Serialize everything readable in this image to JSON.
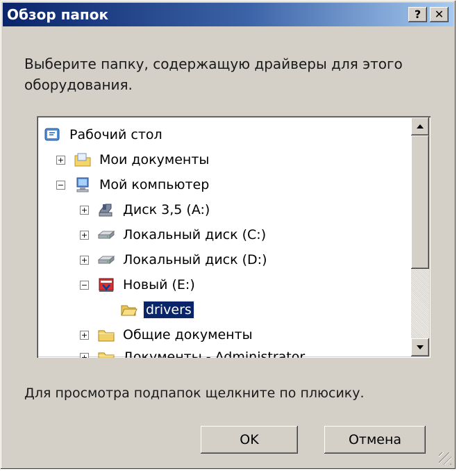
{
  "window": {
    "title": "Обзор папок",
    "help_label": "?",
    "close_label": "✕"
  },
  "prompt": "Выберите папку, содержащую драйверы для этого оборудования.",
  "tree": {
    "items": [
      {
        "label": "Рабочий стол",
        "icon": "desktop-icon",
        "expander": ""
      },
      {
        "label": "Мои документы",
        "icon": "documents-folder-icon",
        "expander": "+"
      },
      {
        "label": "Мой компьютер",
        "icon": "computer-icon",
        "expander": "−"
      },
      {
        "label": "Диск 3,5 (A:)",
        "icon": "floppy-drive-icon",
        "expander": "+"
      },
      {
        "label": "Локальный диск (C:)",
        "icon": "hard-drive-icon",
        "expander": "+"
      },
      {
        "label": "Локальный диск (D:)",
        "icon": "hard-drive-icon",
        "expander": "+"
      },
      {
        "label": "Новый (E:)",
        "icon": "removable-drive-icon",
        "expander": "−"
      },
      {
        "label": "drivers",
        "icon": "folder-open-icon",
        "expander": "",
        "selected": true
      },
      {
        "label": "Общие документы",
        "icon": "folder-icon",
        "expander": "+"
      },
      {
        "label": "Документы - Administrator",
        "icon": "folder-icon",
        "expander": "+"
      }
    ]
  },
  "hint": "Для просмотра подпапок щелкните по плюсику.",
  "buttons": {
    "ok": "OK",
    "cancel": "Отмена"
  },
  "colors": {
    "titlebar_start": "#0a246a",
    "titlebar_end": "#a6caf0",
    "selection": "#0a246a",
    "face": "#d4d0c8"
  }
}
